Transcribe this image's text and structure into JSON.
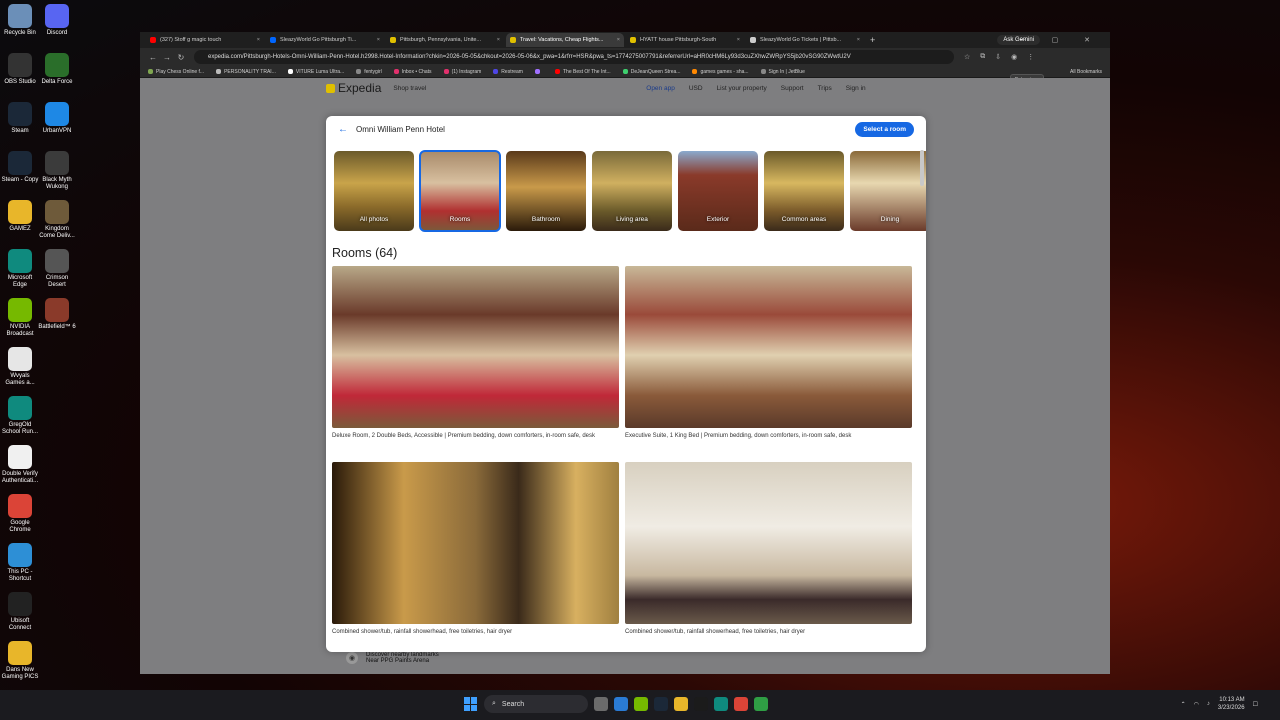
{
  "desktop": {
    "icons": [
      {
        "label": "Recycle Bin",
        "glyph": "trash-icon",
        "color": "#6b8fb8"
      },
      {
        "label": "Discord",
        "glyph": "discord-icon",
        "color": "#5865f2"
      },
      {
        "label": "OBS Studio",
        "glyph": "obs-icon",
        "color": "#333"
      },
      {
        "label": "Delta Force",
        "glyph": "delta-force-icon",
        "color": "#2a6e2a"
      },
      {
        "label": "Steam",
        "glyph": "steam-icon",
        "color": "#1b2838"
      },
      {
        "label": "UrbanVPN",
        "glyph": "vpn-icon",
        "color": "#1e88e5"
      },
      {
        "label": "Steam - Copy",
        "glyph": "steam-icon",
        "color": "#1b2838"
      },
      {
        "label": "Black Myth Wukong",
        "glyph": "game-icon",
        "color": "#3b3b3b"
      },
      {
        "label": "GAMEZ",
        "glyph": "folder-icon",
        "color": "#e8b62a"
      },
      {
        "label": "Kingdom Come Deliv...",
        "glyph": "game-icon",
        "color": "#6e5a3a"
      },
      {
        "label": "Microsoft Edge",
        "glyph": "edge-icon",
        "color": "#0f8a7e"
      },
      {
        "label": "Crimson Desert",
        "glyph": "game-icon",
        "color": "#555"
      },
      {
        "label": "NVIDIA Broadcast",
        "glyph": "nvidia-icon",
        "color": "#76b900"
      },
      {
        "label": "Battlefield™ 6",
        "glyph": "game-icon",
        "color": "#8a3a2a"
      },
      {
        "label": "Wvyals Games a...",
        "glyph": "document-icon",
        "color": "#e6e6e6"
      },
      {
        "label": "GregOld School Run...",
        "glyph": "edge-icon",
        "color": "#0f8a7e"
      },
      {
        "label": "Double Verify Authenticati...",
        "glyph": "document-icon",
        "color": "#f0f0f0"
      },
      {
        "label": "Google Chrome",
        "glyph": "chrome-icon",
        "color": "#db4437"
      },
      {
        "label": "This PC - Shortcut",
        "glyph": "pc-icon",
        "color": "#2d8fd6"
      },
      {
        "label": "Ubisoft Connect",
        "glyph": "ubisoft-icon",
        "color": "#222"
      },
      {
        "label": "Dans New Gaming PICS",
        "glyph": "folder-icon",
        "color": "#e8b62a"
      }
    ]
  },
  "browser": {
    "tabs": [
      {
        "label": "(327) Stoff g magic touch",
        "favicon_color": "#ff0000",
        "active": false
      },
      {
        "label": "SleazyWorld Go Pittsburgh Ti...",
        "favicon_color": "#0066ff",
        "active": false
      },
      {
        "label": "Pittsburgh, Pennsylvania, Unite...",
        "favicon_color": "#e0c000",
        "active": false
      },
      {
        "label": "Travel: Vacations, Cheap Flights...",
        "favicon_color": "#e0c000",
        "active": true
      },
      {
        "label": "HYATT house Pittsburgh-South",
        "favicon_color": "#e0c000",
        "active": false
      },
      {
        "label": "SleazyWorld Go Tickets | Pittsb...",
        "favicon_color": "#cccccc",
        "active": false
      }
    ],
    "new_tab": "+",
    "ask_gemini": "Ask Gemini",
    "url": "expedia.com/Pittsburgh-Hotels-Omni-William-Penn-Hotel.h2998.Hotel-Information?chkin=2026-05-05&chkout=2026-05-06&x_pwa=1&rfrr=HSR&pwa_ts=1774275007791&referrerUrl=aHR0cHM6Ly93d3cuZXhwZWRpYS5jb20vSG90ZWwtU2V",
    "extensions_tooltip": "Extensions",
    "bookmarks": [
      {
        "label": "Play Chess Online f...",
        "color": "#7fa650"
      },
      {
        "label": "PERSONALITY TRAI...",
        "color": "#bbbbbb"
      },
      {
        "label": "VITURE Luma Ultra...",
        "color": "#ffffff"
      },
      {
        "label": "fentygirl",
        "color": "#888888"
      },
      {
        "label": "Inbox • Chats",
        "color": "#e1306c"
      },
      {
        "label": "(1) Instagram",
        "color": "#e1306c"
      },
      {
        "label": "Restream",
        "color": "#4f46e5"
      },
      {
        "label": "",
        "color": "#a070ff"
      },
      {
        "label": "The Best Of The Int...",
        "color": "#ff0000"
      },
      {
        "label": "DeJeanQueen Strea...",
        "color": "#3ecf6e"
      },
      {
        "label": "games games - sha...",
        "color": "#ff8800"
      },
      {
        "label": "Sign In | JetBlue",
        "color": "#888888"
      }
    ],
    "all_bookmarks": "All Bookmarks"
  },
  "expedia": {
    "logo": "Expedia",
    "shop_travel": "Shop travel",
    "open_app": "Open app",
    "currency": "USD",
    "list_property": "List your property",
    "support": "Support",
    "trips": "Trips",
    "sign_in": "Sign in",
    "landmarks_title": "Discover nearby landmarks",
    "landmarks_sub": "Near PPG Paints Arena"
  },
  "modal": {
    "hotel_name": "Omni William Penn Hotel",
    "select_room": "Select a room",
    "categories": [
      {
        "label": "All photos",
        "active": false
      },
      {
        "label": "Rooms",
        "active": true
      },
      {
        "label": "Bathroom",
        "active": false
      },
      {
        "label": "Living area",
        "active": false
      },
      {
        "label": "Exterior",
        "active": false
      },
      {
        "label": "Common areas",
        "active": false
      },
      {
        "label": "Dining",
        "active": false
      }
    ],
    "rooms_title": "Rooms (64)",
    "photos": [
      {
        "caption": "Deluxe Room, 2 Double Beds, Accessible | Premium bedding, down comforters, in-room safe, desk"
      },
      {
        "caption": "Executive Suite, 1 King Bed | Premium bedding, down comforters, in-room safe, desk"
      },
      {
        "caption": "Combined shower/tub, rainfall showerhead, free toiletries, hair dryer"
      },
      {
        "caption": "Combined shower/tub, rainfall showerhead, free toiletries, hair dryer"
      }
    ]
  },
  "taskbar": {
    "search": "Search",
    "time": "10:13 AM",
    "date": "3/23/2026"
  }
}
